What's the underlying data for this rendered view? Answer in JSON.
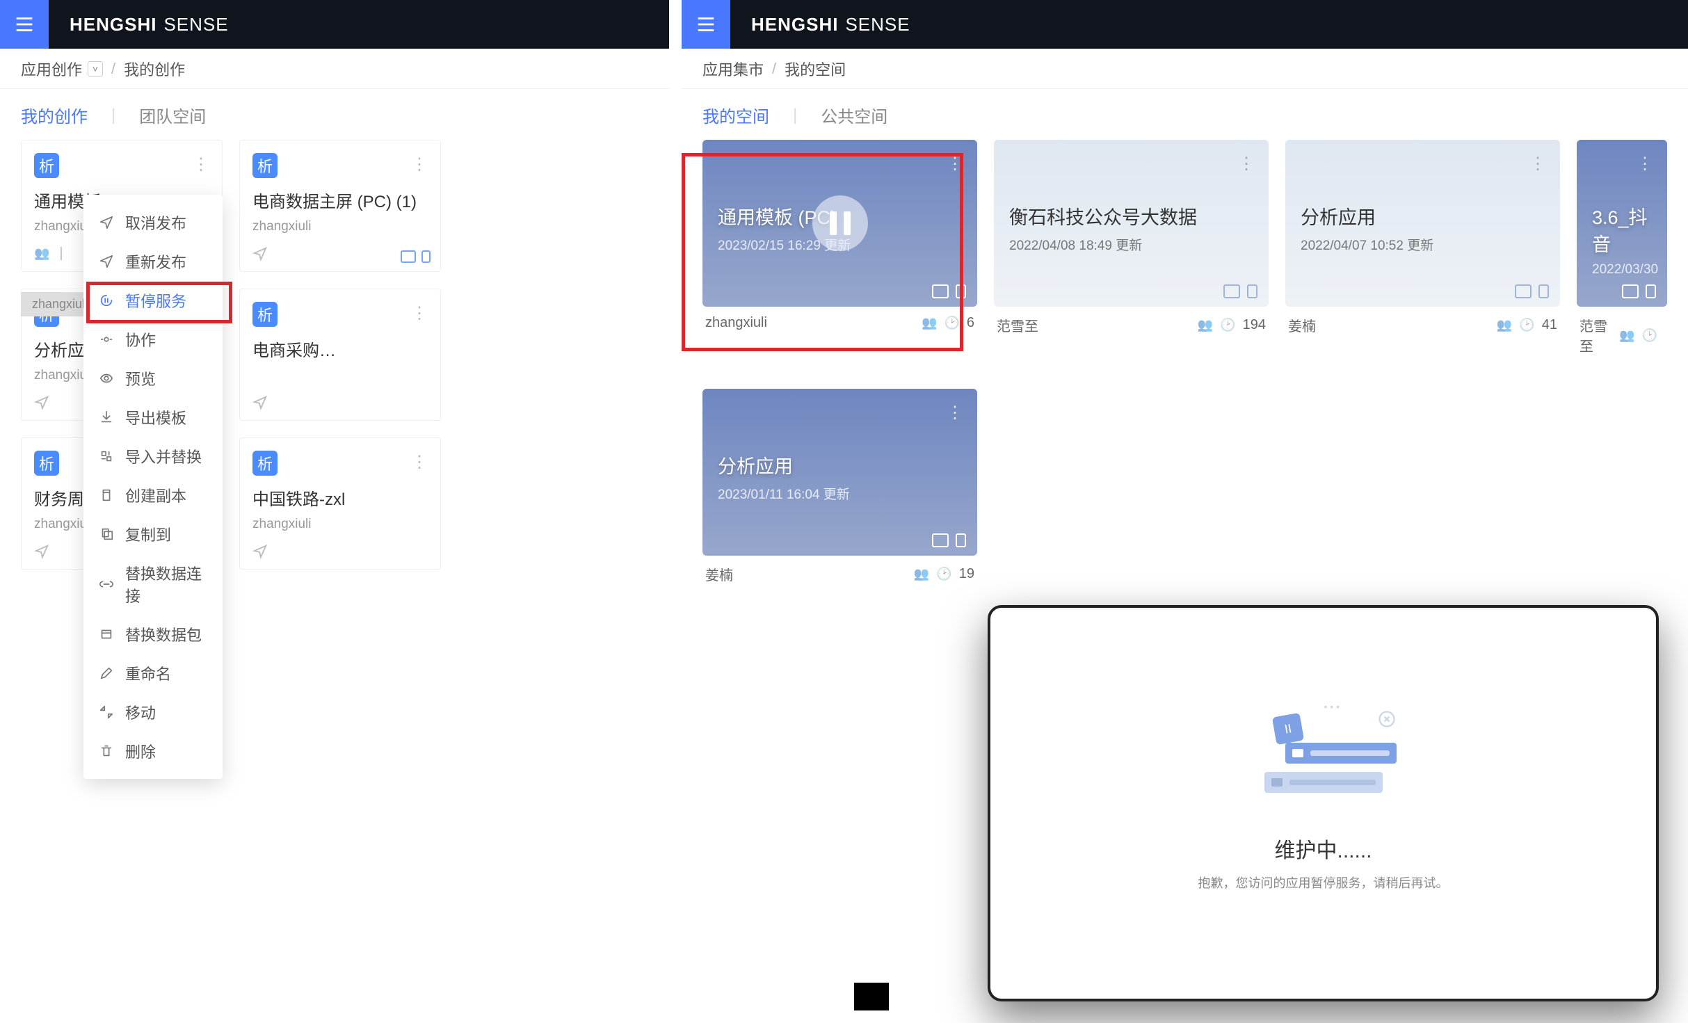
{
  "brand": {
    "bold": "HENGSHI",
    "light": "SENSE"
  },
  "left": {
    "crumb1": "应用创作",
    "crumb2": "我的创作",
    "tab_active": "我的创作",
    "tab_other": "团队空间",
    "strip": "zhangxiuli",
    "cards": [
      {
        "badge": "析",
        "title": "通用模板…",
        "author": "zhangxiu…"
      },
      {
        "badge": "析",
        "title": "电商数据主屏 (PC) (1)",
        "author": "zhangxiuli"
      },
      {
        "badge": "析",
        "title": "分析应用abc",
        "author": "zhangxiuli"
      },
      {
        "badge": "析",
        "title": "电商采购…",
        "author": ""
      },
      {
        "badge": "析",
        "title": "财务周报",
        "author": "zhangxiuli"
      },
      {
        "badge": "析",
        "title": "中国铁路-zxl",
        "author": "zhangxiuli"
      }
    ],
    "menu": [
      "取消发布",
      "重新发布",
      "暂停服务",
      "协作",
      "预览",
      "导出模板",
      "导入并替换",
      "创建副本",
      "复制到",
      "替换数据连接",
      "替换数据包",
      "重命名",
      "移动",
      "删除"
    ],
    "menu_highlight_index": 2
  },
  "right": {
    "crumb1": "应用集市",
    "crumb2": "我的空间",
    "tab_active": "我的空间",
    "tab_other": "公共空间",
    "cards": [
      {
        "title": "通用模板 (PC)",
        "sub": "2023/02/15 16:29 更新",
        "author": "zhangxiuli",
        "count": "6",
        "paused": true,
        "alt": false
      },
      {
        "title": "衡石科技公众号大数据",
        "sub": "2022/04/08 18:49 更新",
        "author": "范雪至",
        "count": "194",
        "paused": false,
        "alt": true
      },
      {
        "title": "分析应用",
        "sub": "2022/04/07 10:52 更新",
        "author": "姜楠",
        "count": "41",
        "paused": false,
        "alt": true
      },
      {
        "title": "3.6_抖音",
        "sub": "2022/03/30",
        "author": "范雪至",
        "count": "",
        "paused": false,
        "alt": false,
        "partial": true
      },
      {
        "title": "分析应用",
        "sub": "2023/01/11 16:04 更新",
        "author": "姜楠",
        "count": "19",
        "paused": false,
        "alt": false
      }
    ]
  },
  "modal": {
    "title": "维护中......",
    "sub": "抱歉，您访问的应用暂停服务，请稍后再试。"
  }
}
